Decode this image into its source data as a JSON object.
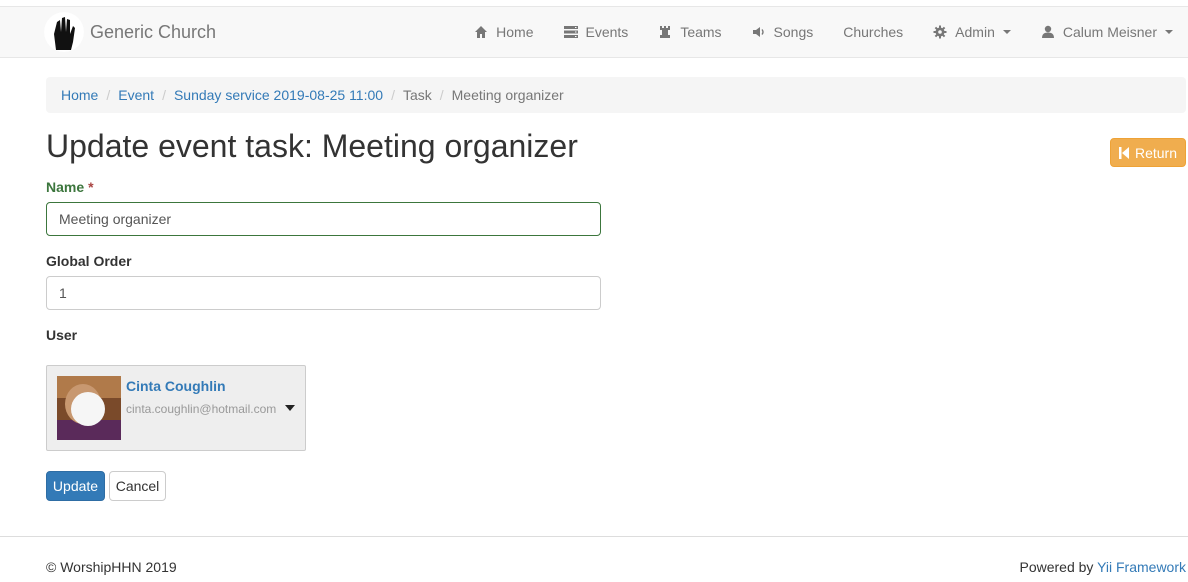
{
  "brand": {
    "name": "Generic Church",
    "logo_icon": "praying-hands-icon"
  },
  "nav": {
    "items": [
      {
        "label": "Home",
        "icon": "home-icon"
      },
      {
        "label": "Events",
        "icon": "server-icon"
      },
      {
        "label": "Teams",
        "icon": "tower-icon"
      },
      {
        "label": "Songs",
        "icon": "volume-icon"
      },
      {
        "label": "Churches",
        "icon": ""
      },
      {
        "label": "Admin",
        "icon": "gear-icon"
      },
      {
        "label": "Calum Meisner",
        "icon": "user-icon"
      }
    ]
  },
  "breadcrumb": {
    "items": [
      "Home",
      "Event",
      "Sunday service 2019-08-25 11:00",
      "Task",
      "Meeting organizer"
    ],
    "separator": "/"
  },
  "page": {
    "title": "Update event task: Meeting organizer",
    "return_label": "Return"
  },
  "form": {
    "name_label": "Name",
    "required_marker": "*",
    "name_value": "Meeting organizer",
    "order_label": "Global Order",
    "order_value": "1",
    "user_label": "User",
    "user": {
      "name": "Cinta Coughlin",
      "email": "cinta.coughlin@hotmail.com"
    },
    "update_label": "Update",
    "cancel_label": "Cancel"
  },
  "footer": {
    "copyright": "© WorshipHHN 2019",
    "powered_prefix": "Powered by ",
    "powered_link": "Yii Framework"
  },
  "colors": {
    "primary": "#337ab7",
    "warning": "#f0ad4e",
    "success": "#3c763d",
    "danger": "#a94442"
  }
}
